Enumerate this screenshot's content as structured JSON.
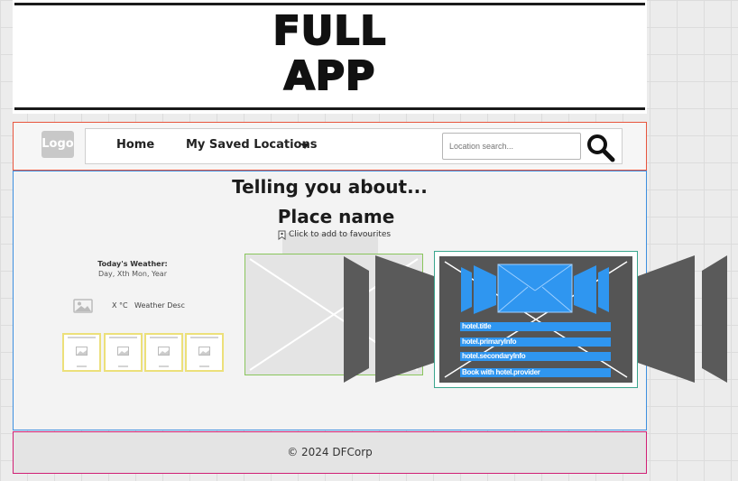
{
  "title": {
    "line1": "FULL",
    "line2": "APP"
  },
  "nav": {
    "logo": "Logo",
    "home": "Home",
    "saved": "My Saved Locations",
    "search_placeholder": "Location search..."
  },
  "main": {
    "heading": "Telling you about...",
    "place": "Place name",
    "favourite": "Click to add to favourites",
    "weather": {
      "title": "Today's Weather:",
      "date": "Day, Xth Mon, Year",
      "temp": "X °C",
      "desc": "Weather Desc"
    },
    "forecast_count_note": "4 cards"
  },
  "hotel": {
    "title": "hotel.title",
    "primary": "hotel.primaryInfo",
    "secondary": "hotel.secondaryInfo",
    "book": "Book with hotel.provider"
  },
  "footer": {
    "text": "©  2024 DFCorp"
  },
  "colors": {
    "nav_border": "#e8553d",
    "main_border": "#3d8fe0",
    "footer_border": "#d11f75",
    "placeholder_border": "#8ac55c",
    "hotel_border": "#3aa58d",
    "forecast_border": "#ece07a",
    "hotel_accent": "#2f96f0"
  }
}
